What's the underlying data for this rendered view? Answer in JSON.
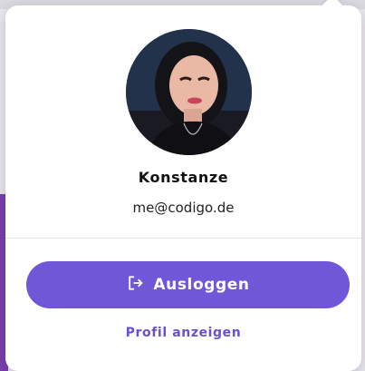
{
  "user": {
    "name": "Konstanze",
    "email": "me@codigo.de"
  },
  "actions": {
    "logout_label": "Ausloggen",
    "profile_label": "Profil anzeigen"
  },
  "icons": {
    "logout": "logout-icon",
    "avatar": "avatar-photo"
  },
  "colors": {
    "accent": "#7057d8",
    "link": "#6a4fd0",
    "sidebar": "#7a3fb0"
  }
}
